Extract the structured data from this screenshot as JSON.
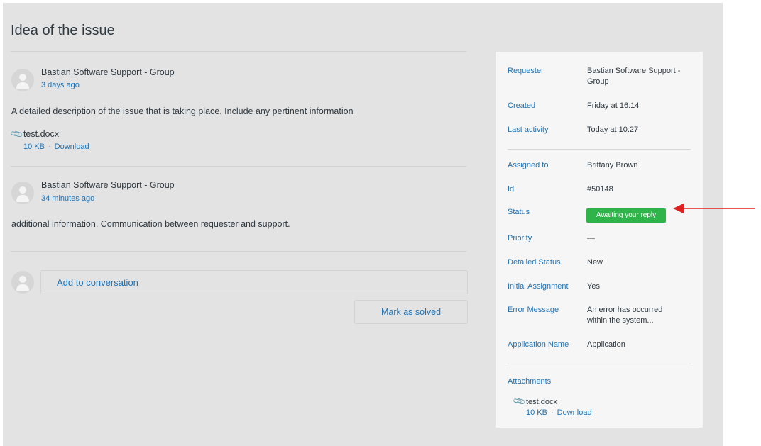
{
  "page": {
    "title": "Idea of the issue"
  },
  "comments": [
    {
      "author": "Bastian Software Support - Group",
      "time": "3 days ago",
      "body": "A detailed description of the issue that is taking place. Include any pertinent information",
      "attachment": {
        "name": "test.docx",
        "size": "10 KB",
        "action": "Download"
      }
    },
    {
      "author": "Bastian Software Support - Group",
      "time": "34 minutes ago",
      "body": "additional information. Communication between requester and support."
    }
  ],
  "reply": {
    "placeholder": "Add to conversation"
  },
  "actions": {
    "mark_solved": "Mark as solved"
  },
  "sidebar": {
    "requester": {
      "label": "Requester",
      "value": "Bastian Software Support - Group"
    },
    "created": {
      "label": "Created",
      "value": "Friday at 16:14"
    },
    "last_activity": {
      "label": "Last activity",
      "value": "Today at 10:27"
    },
    "assigned_to": {
      "label": "Assigned to",
      "value": "Brittany Brown"
    },
    "id": {
      "label": "Id",
      "value": "#50148"
    },
    "status": {
      "label": "Status",
      "value": "Awaiting your reply",
      "color": "#2fb44a"
    },
    "priority": {
      "label": "Priority",
      "value": "—"
    },
    "detailed_status": {
      "label": "Detailed Status",
      "value": "New"
    },
    "initial_assignment": {
      "label": "Initial Assignment",
      "value": "Yes"
    },
    "error_message": {
      "label": "Error Message",
      "value": "An error has occurred within the system..."
    },
    "application_name": {
      "label": "Application Name",
      "value": "Application"
    },
    "attachments": {
      "label": "Attachments",
      "name": "test.docx",
      "size": "10 KB",
      "action": "Download"
    }
  },
  "colors": {
    "link": "#1f73b7",
    "annotation_arrow": "#e02020"
  },
  "icons": {
    "attachment": "paperclip-icon",
    "avatar": "user-avatar-icon",
    "annotation": "red-arrow-icon"
  }
}
